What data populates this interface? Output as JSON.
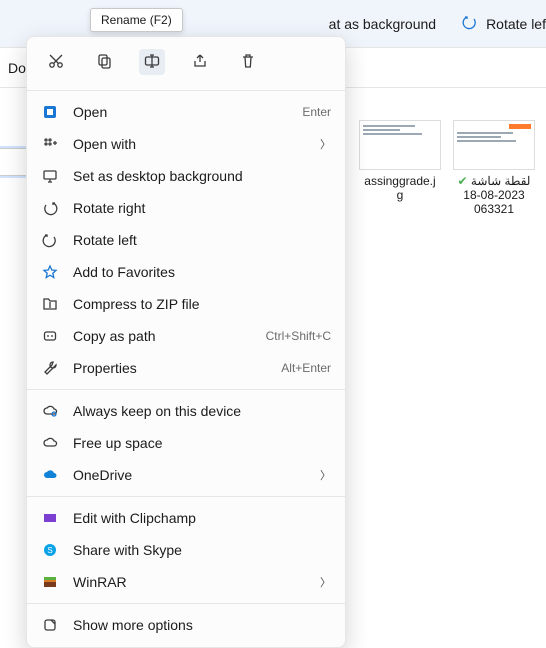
{
  "tooltip": "Rename (F2)",
  "toolbar": {
    "set_bg": "at as background",
    "rotate_left": "Rotate lef"
  },
  "subheader": "Do",
  "files": {
    "item1": {
      "name": "assinggrade.j",
      "ext": "g"
    },
    "item2": {
      "name": "لقطة شاشة 2023-08-18 063321"
    }
  },
  "ctx": {
    "open": "Open",
    "open_k": "Enter",
    "openwith": "Open with",
    "setbg": "Set as desktop background",
    "rr": "Rotate right",
    "rl": "Rotate left",
    "fav": "Add to Favorites",
    "zip": "Compress to ZIP file",
    "path": "Copy as path",
    "path_k": "Ctrl+Shift+C",
    "prop": "Properties",
    "prop_k": "Alt+Enter",
    "keep": "Always keep on this device",
    "free": "Free up space",
    "onedrive": "OneDrive",
    "clip": "Edit with Clipchamp",
    "skype": "Share with Skype",
    "winrar": "WinRAR",
    "more": "Show more options"
  }
}
